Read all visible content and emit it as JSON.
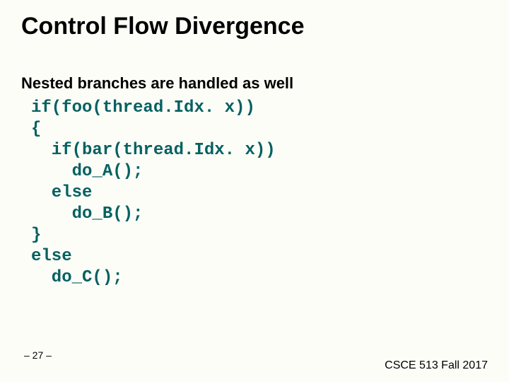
{
  "title": "Control Flow Divergence",
  "subtitle": "Nested branches are handled as well",
  "code": "if(foo(thread.Idx. x))\n{\n  if(bar(thread.Idx. x))\n    do_A();\n  else\n    do_B();\n}\nelse\n  do_C();",
  "page_number": "– 27 –",
  "footer": "CSCE 513 Fall 2017"
}
